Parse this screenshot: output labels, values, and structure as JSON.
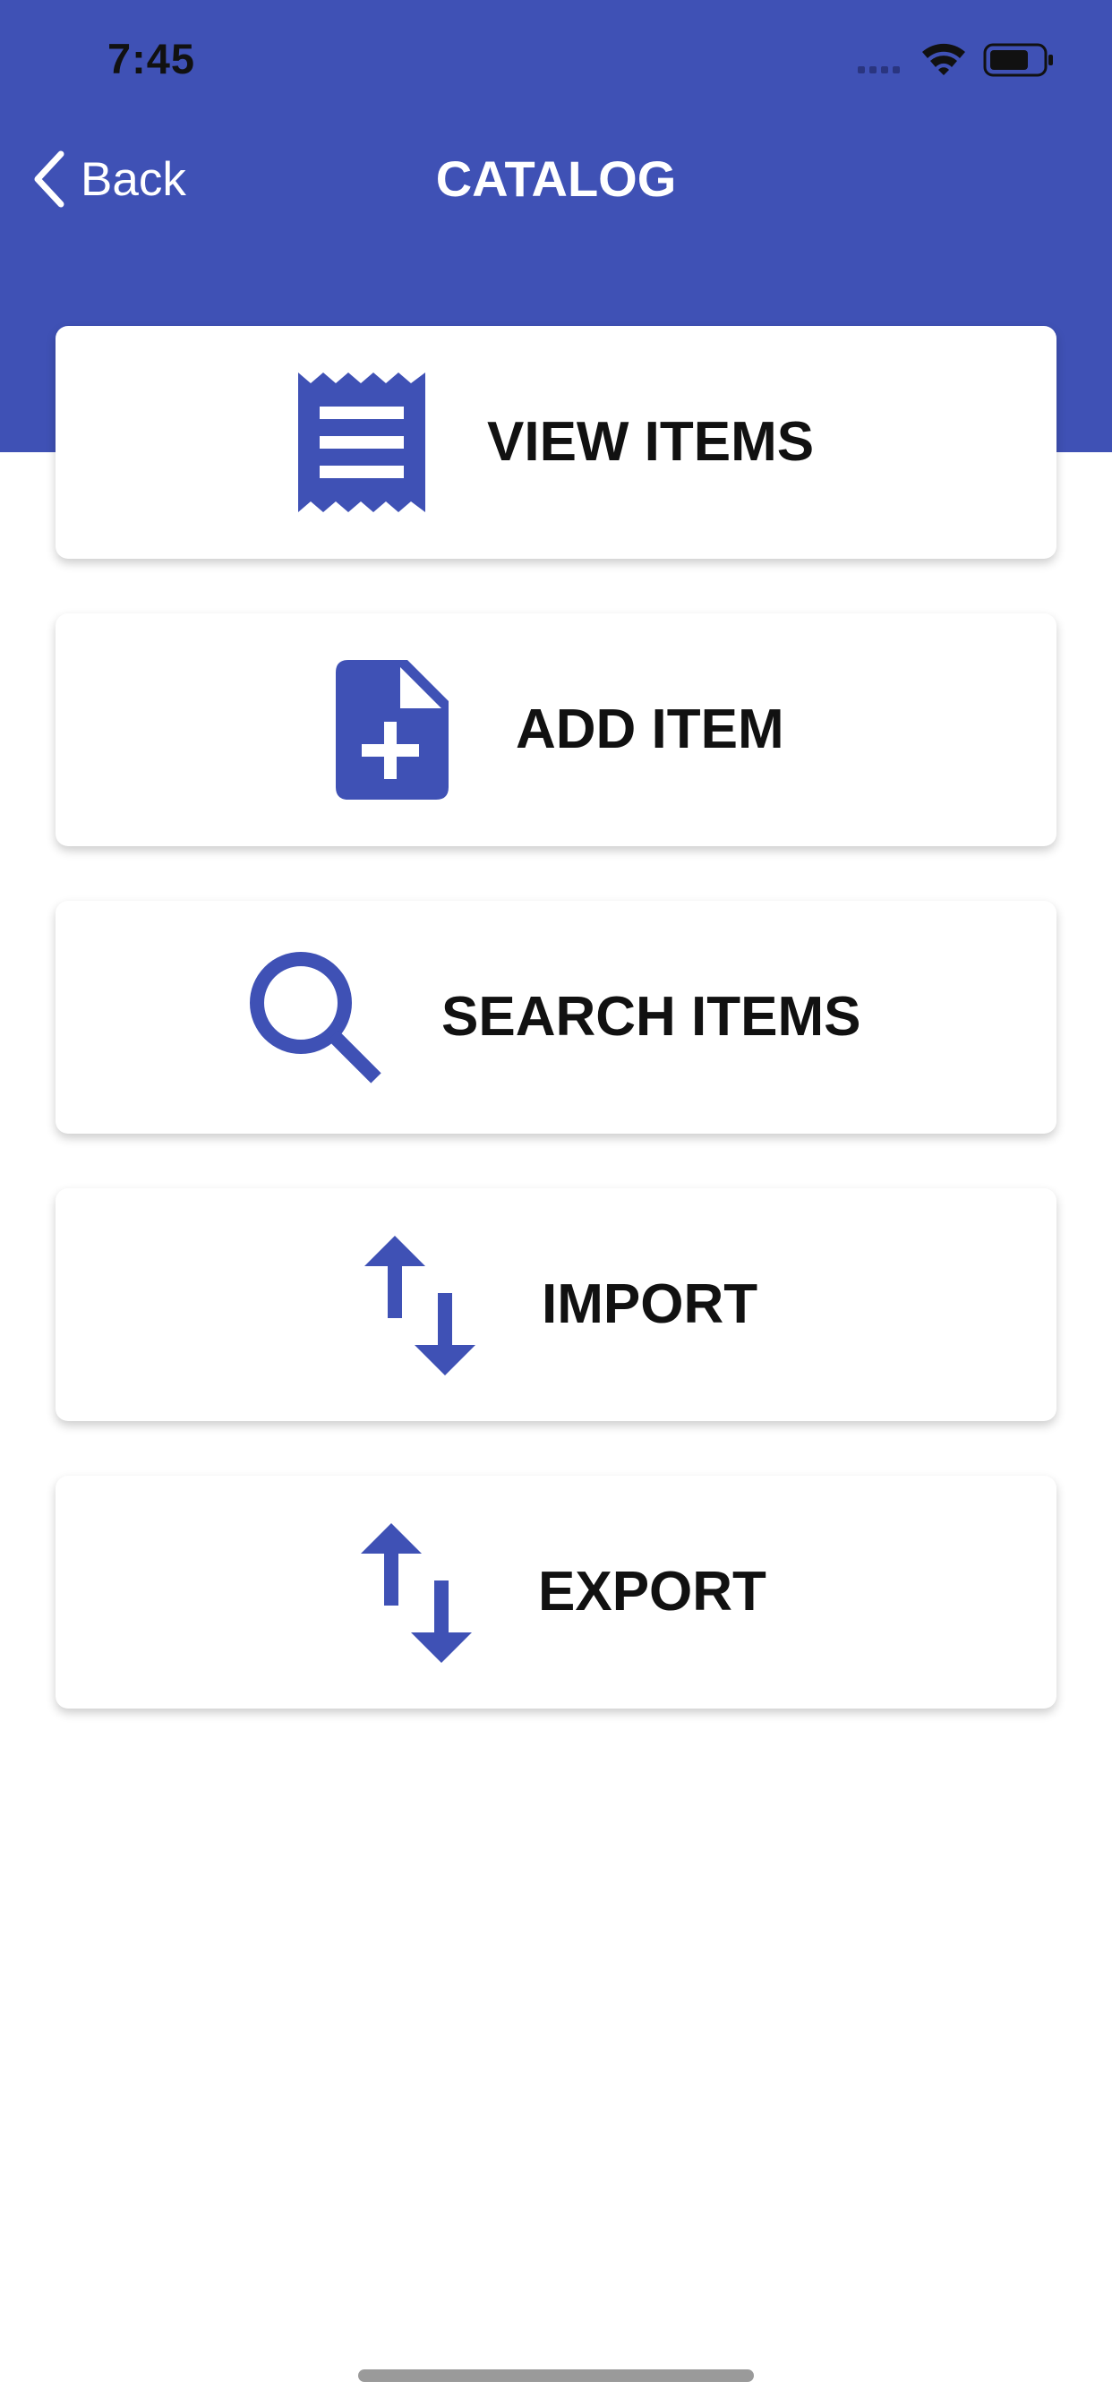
{
  "status_bar": {
    "time": "7:45"
  },
  "nav": {
    "back_label": "Back",
    "title": "CATALOG"
  },
  "theme": {
    "accent": "#3F51B5",
    "background": "#FFFFFF",
    "text": "#111111"
  },
  "menu": [
    {
      "label": "VIEW ITEMS",
      "icon": "receipt-icon"
    },
    {
      "label": "ADD ITEM",
      "icon": "add-file-icon"
    },
    {
      "label": "SEARCH ITEMS",
      "icon": "search-icon"
    },
    {
      "label": "IMPORT",
      "icon": "import-export-icon"
    },
    {
      "label": "EXPORT",
      "icon": "import-export-icon"
    }
  ]
}
